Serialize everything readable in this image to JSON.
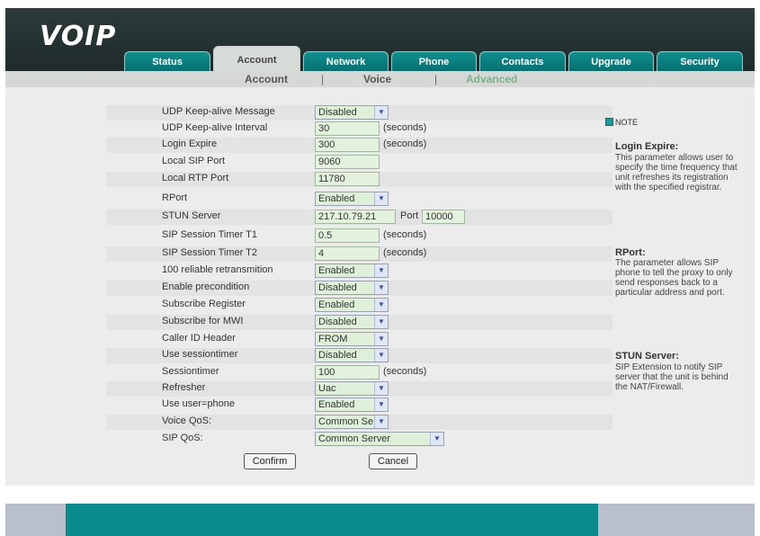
{
  "app": {
    "logo": "VOIP"
  },
  "tabs": [
    "Status",
    "Account",
    "Network",
    "Phone",
    "Contacts",
    "Upgrade",
    "Security"
  ],
  "active_tab": "Account",
  "subnav": {
    "items": [
      "Account",
      "Voice",
      "Advanced"
    ],
    "separator": "|",
    "active": "Advanced"
  },
  "rows": [
    {
      "label": "UDP Keep-alive Message",
      "type": "select",
      "value": "Disabled"
    },
    {
      "label": "UDP Keep-alive Interval",
      "type": "input",
      "value": "30",
      "unit": "(seconds)"
    },
    {
      "label": "Login Expire",
      "type": "input",
      "value": "300",
      "unit": "(seconds)"
    },
    {
      "label": "Local SIP Port",
      "type": "input",
      "value": "9060"
    },
    {
      "label": "Local RTP Port",
      "type": "input",
      "value": "11780"
    },
    {
      "label": "RPort",
      "type": "select",
      "value": "Enabled"
    },
    {
      "label": "STUN Server",
      "type": "input",
      "value": "217.10.79.21",
      "extra_label": "Port",
      "extra_value": "10000"
    },
    {
      "label": "SIP Session Timer T1",
      "type": "input",
      "value": "0.5",
      "unit": "(seconds)"
    },
    {
      "label": "SIP Session Timer T2",
      "type": "input",
      "value": "4",
      "unit": "(seconds)"
    },
    {
      "label": "100 reliable retransmition",
      "type": "select",
      "value": "Enabled"
    },
    {
      "label": "Enable precondition",
      "type": "select",
      "value": "Disabled"
    },
    {
      "label": "Subscribe Register",
      "type": "select",
      "value": "Enabled"
    },
    {
      "label": "Subscribe for MWI",
      "type": "select",
      "value": "Disabled"
    },
    {
      "label": "Caller ID Header",
      "type": "select",
      "value": "FROM"
    },
    {
      "label": "Use sessiontimer",
      "type": "select",
      "value": "Disabled"
    },
    {
      "label": "Sessiontimer",
      "type": "input",
      "value": "100",
      "unit": "(seconds)"
    },
    {
      "label": "Refresher",
      "type": "select",
      "value": "Uac"
    },
    {
      "label": "Use user=phone",
      "type": "select",
      "value": "Enabled"
    },
    {
      "label": "Voice QoS:",
      "type": "select",
      "value": "Common Se"
    },
    {
      "label": "SIP QoS:",
      "type": "select_wide",
      "value": "Common Server"
    }
  ],
  "buttons": {
    "confirm": "Confirm",
    "cancel": "Cancel"
  },
  "note": {
    "title": "NOTE",
    "items": [
      {
        "heading": "Login Expire:",
        "body": "This parameter allows user to specify the time frequency that unit refreshes its registration with the specified registrar."
      },
      {
        "heading": "RPort:",
        "body": "The parameter allows SIP phone to tell the proxy to only send responses back to a particular address and port."
      },
      {
        "heading": "STUN Server:",
        "body": "SIP Extension to notify SIP server that the unit is behind the NAT/Firewall."
      }
    ]
  },
  "icons": {
    "note": "note-icon",
    "dropdown": "chevron-down-icon"
  },
  "colors": {
    "header": "#2c3a3a",
    "tab": "#0f8f8f",
    "footer": "#0a8b8b",
    "field": "#e2f2dc",
    "accent": "#7bb08c"
  }
}
